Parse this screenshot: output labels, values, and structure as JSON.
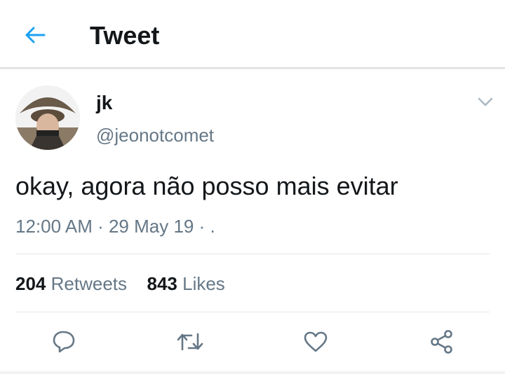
{
  "header": {
    "title": "Tweet",
    "back_icon": "arrow-left-icon",
    "accent_color": "#1da1f2"
  },
  "tweet": {
    "author_name": "jk",
    "author_handle": "@jeonotcomet",
    "text": "okay, agora não posso mais evitar",
    "time": "12:00 AM",
    "date": "29 May 19",
    "meta_sep": " · ",
    "meta_tail": "."
  },
  "stats": {
    "retweets_count": "204",
    "retweets_label": "Retweets",
    "likes_count": "843",
    "likes_label": "Likes"
  },
  "actions": [
    {
      "name": "reply",
      "icon": "reply-icon"
    },
    {
      "name": "retweet",
      "icon": "retweet-icon"
    },
    {
      "name": "like",
      "icon": "heart-icon"
    },
    {
      "name": "share",
      "icon": "share-icon"
    }
  ],
  "colors": {
    "text_primary": "#14171a",
    "text_secondary": "#657786",
    "divider": "#e1e8ed"
  }
}
